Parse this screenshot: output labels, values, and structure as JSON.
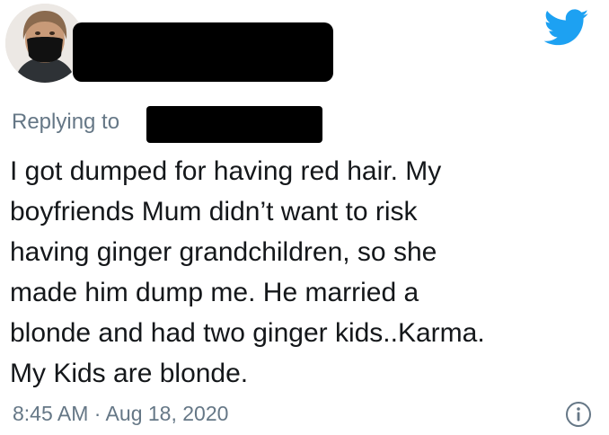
{
  "header": {
    "avatar_icon": "user-avatar-masked",
    "brand_icon": "twitter-bird-icon",
    "brand_color": "#1da1f2"
  },
  "reply": {
    "prefix": "Replying to"
  },
  "tweet": {
    "lines": [
      "I got dumped for having red hair. My",
      "boyfriends Mum  didn’t want to risk",
      "having ginger grandchildren, so she",
      "made him dump me. He married a",
      "blonde and had two ginger kids..Karma.",
      "My Kids are blonde."
    ],
    "timestamp": "8:45 AM · Aug 18, 2020",
    "info_icon": "info-icon"
  },
  "colors": {
    "text": "#14171a",
    "secondary_text": "#657786",
    "redaction": "#000000"
  }
}
